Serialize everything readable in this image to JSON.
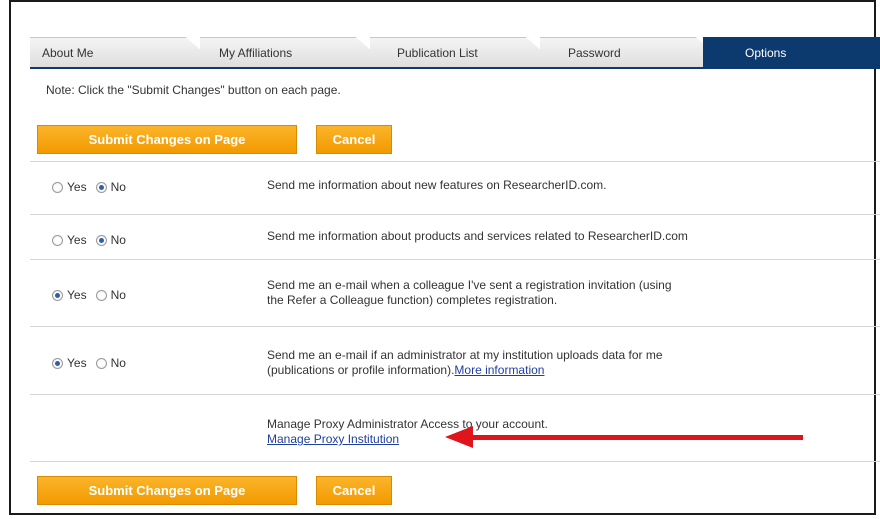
{
  "tabs": [
    {
      "label": "About Me"
    },
    {
      "label": "My Affiliations"
    },
    {
      "label": "Publication List"
    },
    {
      "label": "Password"
    },
    {
      "label": "Options",
      "active": true
    }
  ],
  "note": "Note: Click the \"Submit Changes\" button on each page.",
  "buttons": {
    "submit_label": "Submit Changes on Page",
    "cancel_label": "Cancel"
  },
  "radio_labels": {
    "yes": "Yes",
    "no": "No"
  },
  "options": [
    {
      "selected": "No",
      "text": "Send me information about new features on ResearcherID.com."
    },
    {
      "selected": "No",
      "text": "Send me information about products and services related to ResearcherID.com"
    },
    {
      "selected": "Yes",
      "text_line1": "Send me an e-mail when a colleague I've sent a registration invitation (using",
      "text_line2": "the Refer a Colleague function) completes registration."
    },
    {
      "selected": "Yes",
      "text_line1": "Send me an e-mail if an administrator at my institution uploads data for me",
      "text_line2": "(publications or profile information).",
      "link": "More information"
    }
  ],
  "proxy": {
    "text": "Manage Proxy Administrator Access to your account.",
    "link": "Manage Proxy Institution"
  },
  "colors": {
    "accent_blue": "#0d3a6e",
    "button_orange": "#f7a814",
    "arrow_red": "#e0141b",
    "link_blue": "#1f3fa0"
  }
}
